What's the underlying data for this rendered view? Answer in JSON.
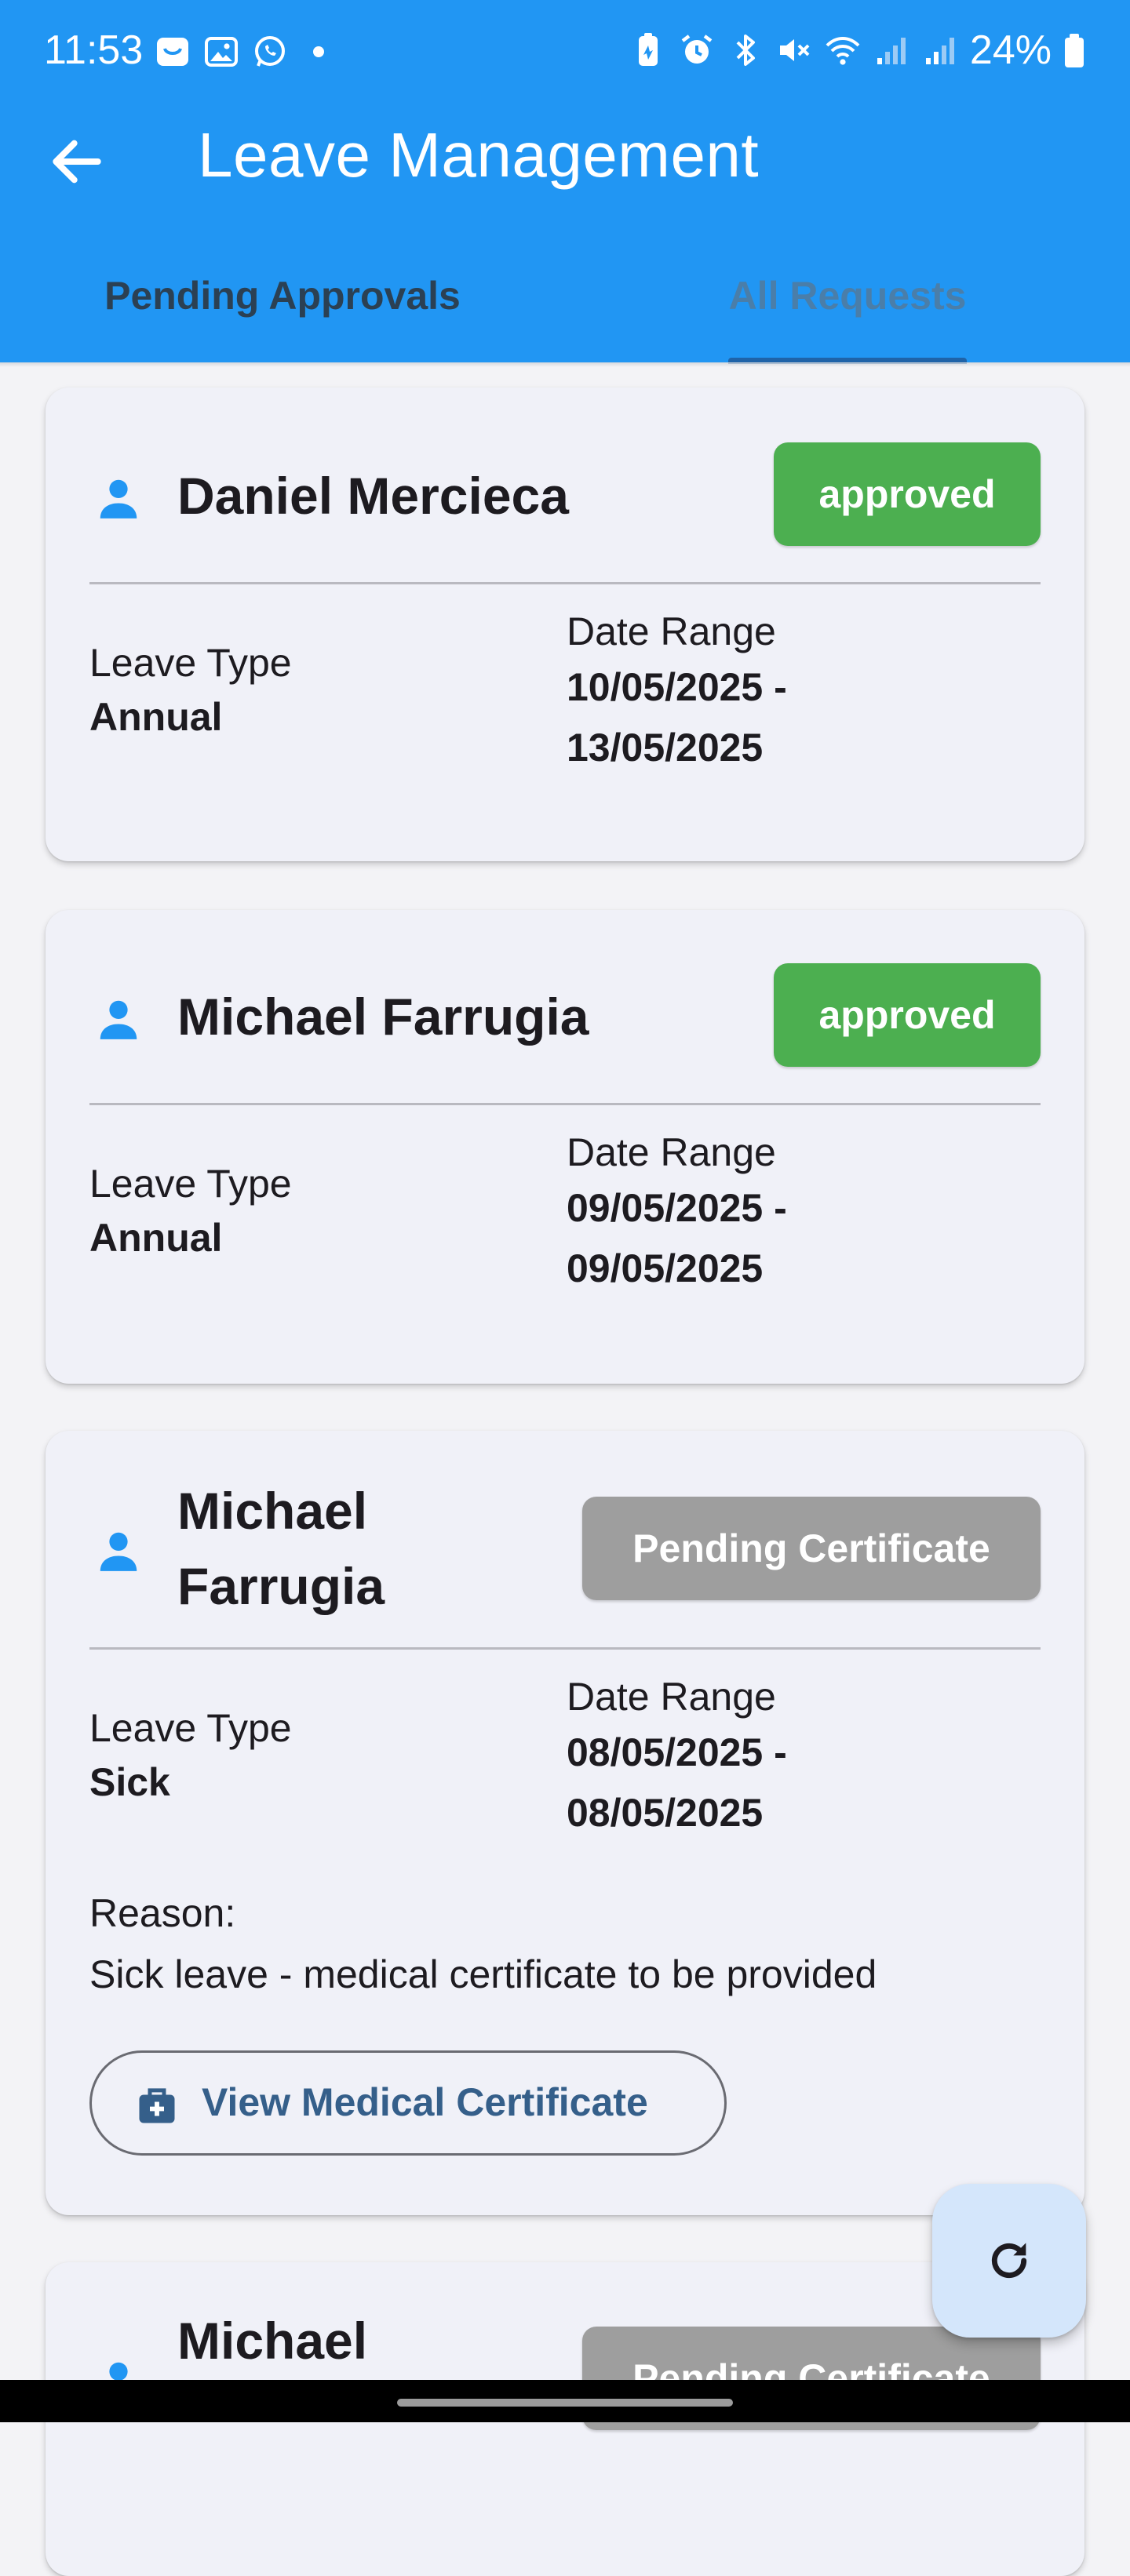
{
  "status_bar": {
    "time": "11:53",
    "battery": "24%",
    "left_icons": [
      "shopping-bag-icon",
      "gallery-icon",
      "whatsapp-icon",
      "dot-icon"
    ],
    "right_icons": [
      "battery-saver-icon",
      "alarm-icon",
      "bluetooth-icon",
      "mute-icon",
      "wifi-icon",
      "signal-icon",
      "signal-icon",
      "battery-icon"
    ]
  },
  "appbar": {
    "title": "Leave Management",
    "back_icon": "arrow-back-icon",
    "color": "#2196f3"
  },
  "tabs": [
    {
      "label": "Pending Approvals",
      "selected": false
    },
    {
      "label": "All Requests",
      "selected": true
    }
  ],
  "requests": [
    {
      "name": "Daniel Mercieca",
      "status": "approved",
      "leave_type_label": "Leave Type",
      "leave_type": "Annual",
      "date_range_label": "Date Range",
      "date_start": "10/05/2025 -",
      "date_end": "13/05/2025"
    },
    {
      "name": "Michael Farrugia",
      "status": "approved",
      "leave_type_label": "Leave Type",
      "leave_type": "Annual",
      "date_range_label": "Date Range",
      "date_start": "09/05/2025 -",
      "date_end": "09/05/2025"
    },
    {
      "name_line1": "Michael",
      "name_line2": "Farrugia",
      "status": "Pending Certificate",
      "leave_type_label": "Leave Type",
      "leave_type": "Sick",
      "date_range_label": "Date Range",
      "date_start": "08/05/2025 -",
      "date_end": "08/05/2025",
      "reason_label": "Reason:",
      "reason": "Sick leave - medical certificate to be provided",
      "certificate_button": "View Medical Certificate"
    },
    {
      "name_line1": "Michael",
      "status": "Pending Certificate"
    }
  ],
  "colors": {
    "approved": "#4caf50",
    "pending": "#9e9e9e",
    "card_bg": "#f0f1f8",
    "fab_bg": "#d4e6fb"
  },
  "fab": {
    "icon": "refresh-icon"
  }
}
